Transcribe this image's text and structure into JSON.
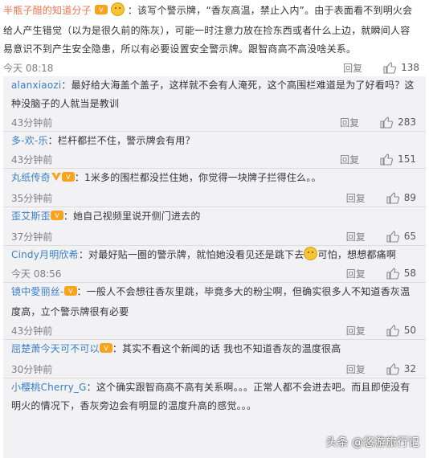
{
  "post": {
    "username": "半瓶子醋的知道分子",
    "text": "：该写个警示牌，“香灰高温，禁止入内”。由于表面看不到明火会给人产生错觉（以为是很久前的陈灰），可能一时注意力放在捡东西或者什么上边，就瞬间人容易意识不到产生安全隐患，所以有必要设置安全警示牌。跟智商高不高没啥关系。",
    "time": "今天 08:18",
    "reply": "回复",
    "likes": "138"
  },
  "comments": [
    {
      "username": "alanxiaozi",
      "text": "：最好给大海盖个盖子，这样就不会有人淹死，这个高围栏难道是为了好看吗？这种没脑子的人就当是教训",
      "time": "43分钟前",
      "reply": "回复",
      "likes": "283",
      "badges": []
    },
    {
      "username": "多-欢-乐",
      "text": "：栏杆都拦不住，警示牌会有用？",
      "time": "43分钟前",
      "reply": "回复",
      "likes": "151",
      "badges": []
    },
    {
      "username": "丸纸传奇",
      "text": "：1米多的围栏都没拦住她，你觉得一块牌子拦得住么。。",
      "time": "35分钟前",
      "reply": "回复",
      "likes": "89",
      "badges": [
        "vip-badge",
        "level-badge"
      ]
    },
    {
      "username": "歪艾斯歪",
      "text": "：她自己视频里说开侧门进去的",
      "time": "37分钟前",
      "reply": "回复",
      "likes": "65",
      "badges": [
        "level-badge"
      ]
    },
    {
      "username": "Cindy月明欣希",
      "text": "：对最好贴一圈的警示牌，就怕她没看见还是跳下去",
      "text2": "可怕，想想都痛啊",
      "time": "今天 08:56",
      "reply": "回复",
      "likes": "58",
      "badges": []
    },
    {
      "username": "镜中愛丽丝-",
      "text": "：一般人不会想往香灰里跳，毕竟多大的粉尘啊，但确实很多人不知道香灰温度高，立个警示牌很有必要",
      "time": "43分钟前",
      "reply": "回复",
      "likes": "50",
      "badges": [
        "level-badge"
      ]
    },
    {
      "username": "屈楚萧今天可不可以",
      "text": "：其实不看这个新闻的话 我也不知道香灰的温度很高",
      "time": "30分钟前",
      "reply": "回复",
      "likes": "32",
      "badges": [
        "level-badge"
      ]
    },
    {
      "username": "小樱桃Cherry_G",
      "text": "：这个确实跟智商高不高有关系啊。。。正常人都不会进去吧。而且即使没有明火的情况下，香灰旁边会有明显的温度升高的感觉。。。",
      "time": "",
      "reply": "",
      "likes": "",
      "badges": []
    }
  ],
  "watermark": "头条 @悠游旅行记",
  "colors": {
    "username": "#eb7350",
    "link": "#3b7fc4",
    "panel": "#f2f2f5"
  }
}
